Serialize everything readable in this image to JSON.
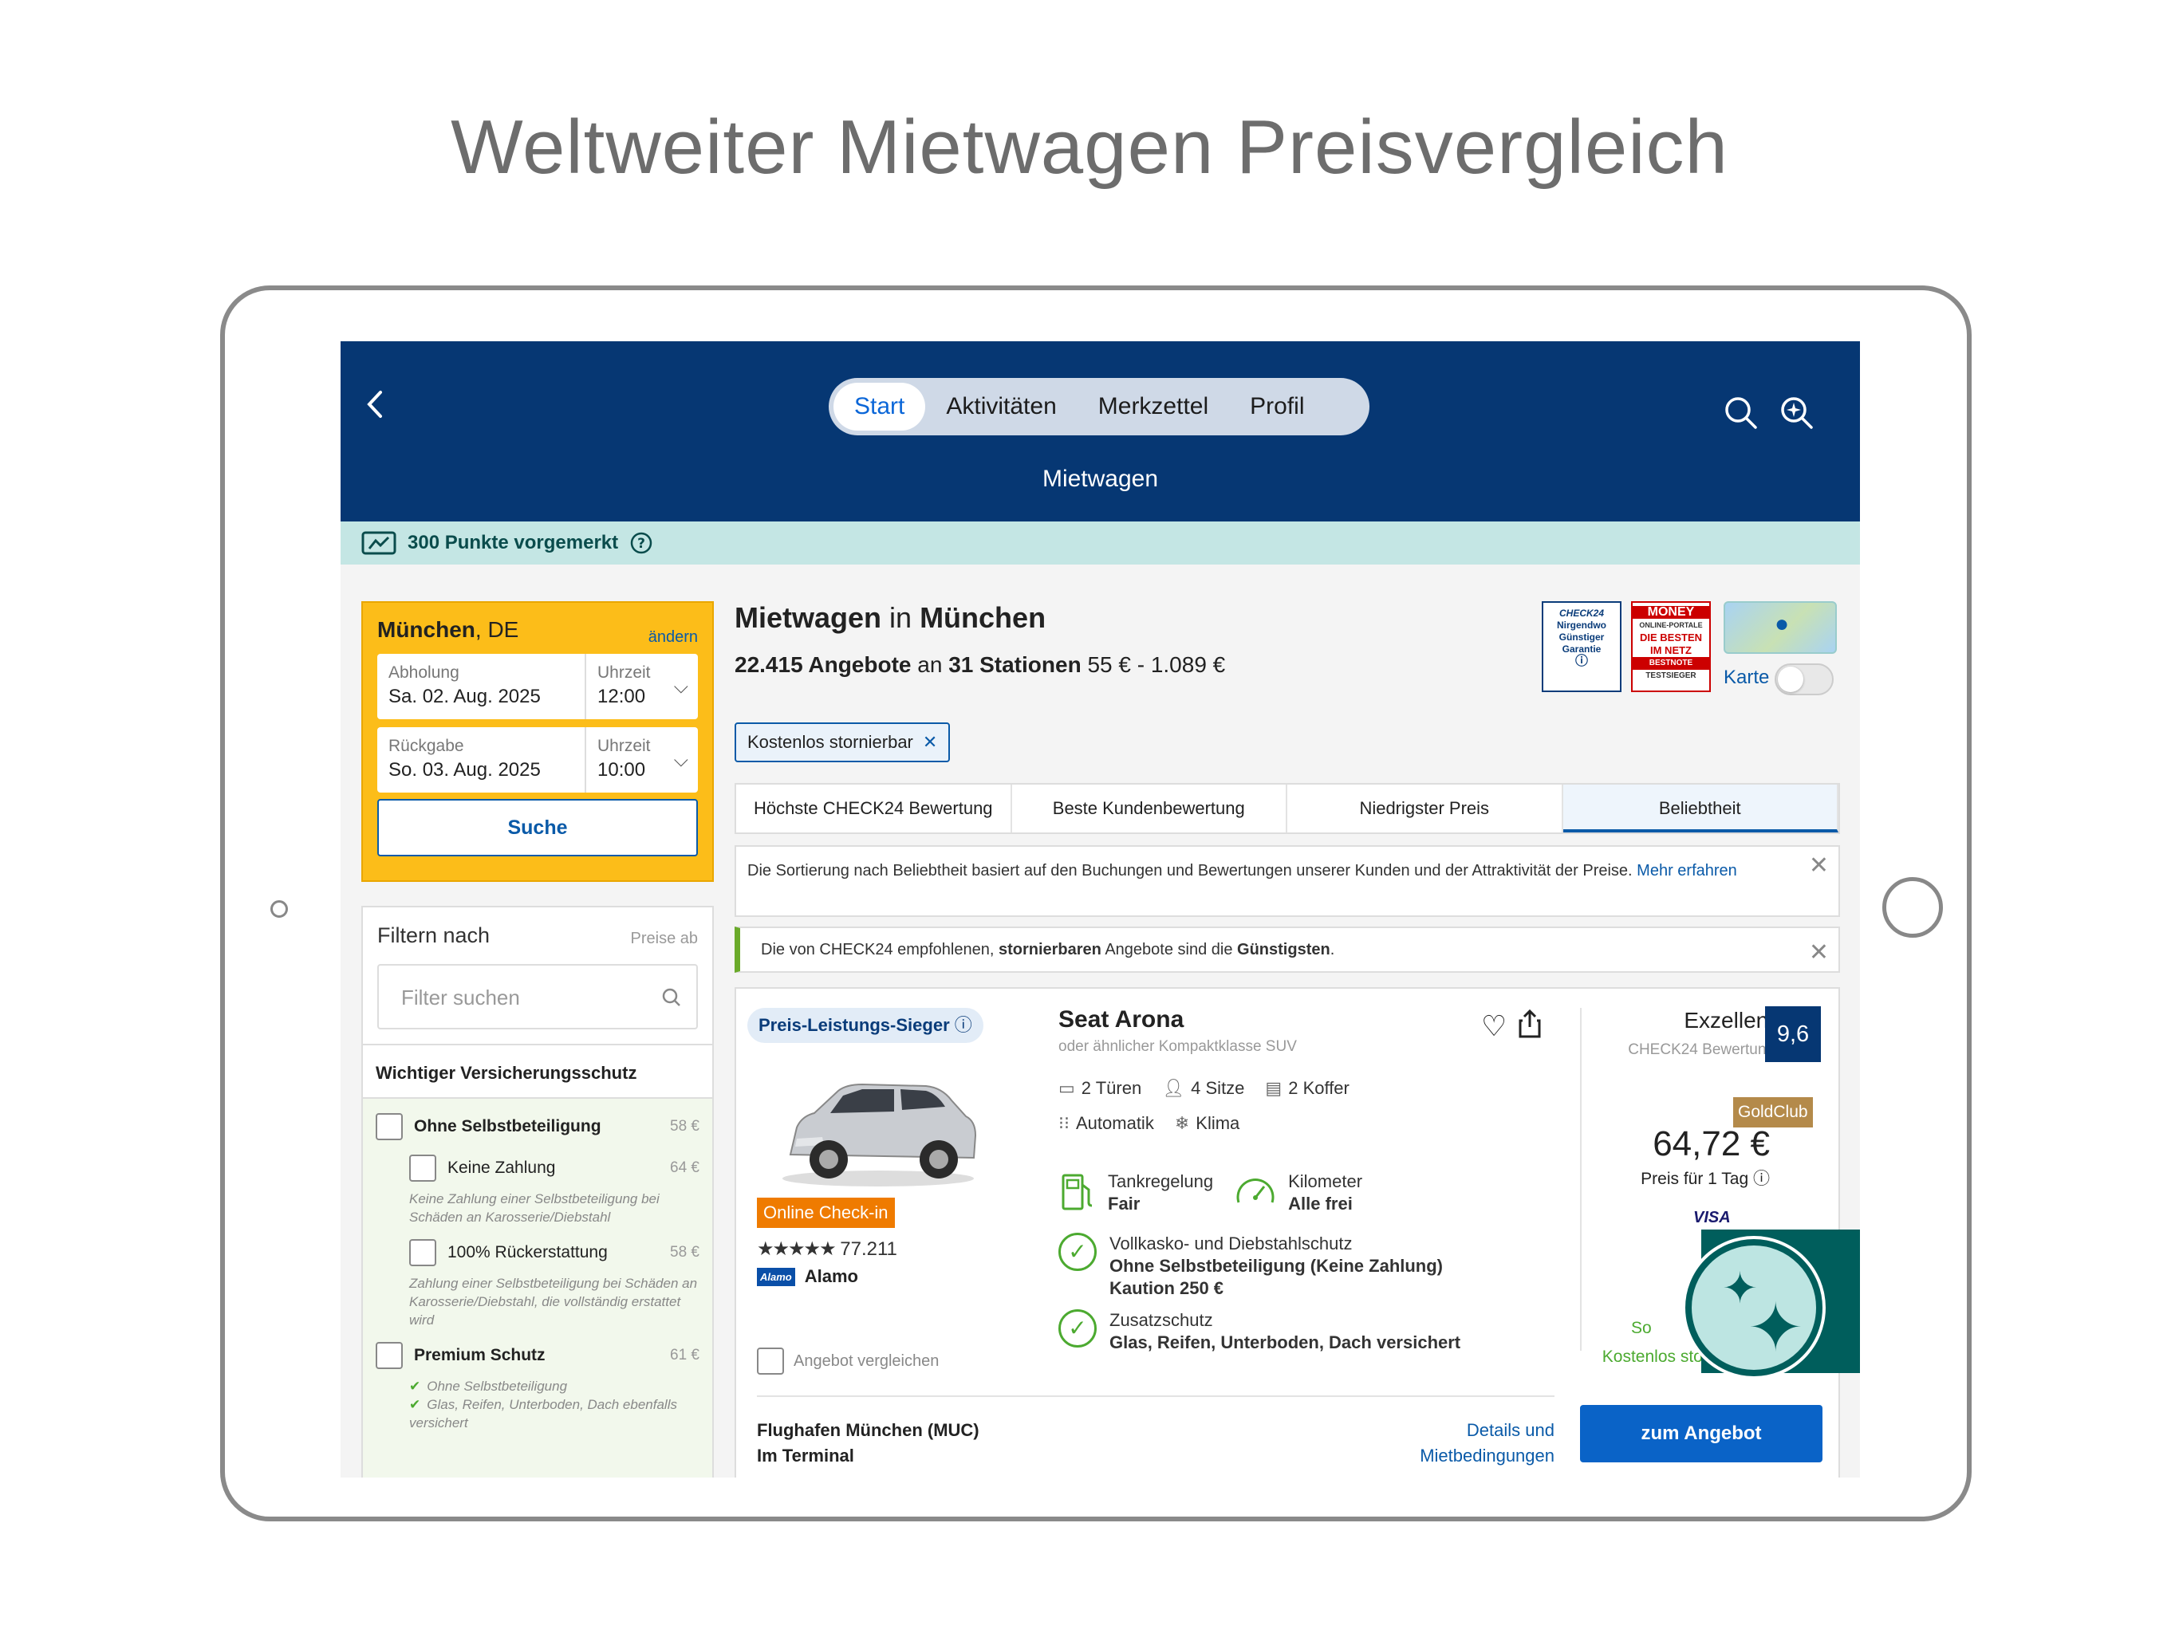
{
  "headline": "Weltweiter Mietwagen Preisvergleich",
  "nav": {
    "tabs": [
      "Start",
      "Aktivitäten",
      "Merkzettel",
      "Profil"
    ],
    "active_tab": "Start",
    "title": "Mietwagen"
  },
  "points_bar": {
    "text": "300 Punkte vorgemerkt"
  },
  "search": {
    "city": "München",
    "country": ", DE",
    "change_label": "ändern",
    "pickup_label": "Abholung",
    "pickup_date": "Sa. 02. Aug. 2025",
    "pickup_time_label": "Uhrzeit",
    "pickup_time": "12:00",
    "return_label": "Rückgabe",
    "return_date": "So. 03. Aug. 2025",
    "return_time_label": "Uhrzeit",
    "return_time": "10:00",
    "search_button": "Suche"
  },
  "filter": {
    "title": "Filtern nach",
    "price_hint": "Preise ab",
    "search_placeholder": "Filter suchen",
    "section_title": "Wichtiger Versicherungsschutz",
    "options": [
      {
        "label": "Ohne Selbstbeteiligung",
        "price": "58 €"
      },
      {
        "label": "Keine Zahlung",
        "price": "64 €",
        "note": "Keine Zahlung einer Selbstbeteiligung bei Schäden an Karosserie/Diebstahl"
      },
      {
        "label": "100% Rückerstattung",
        "price": "58 €",
        "note": "Zahlung einer Selbstbeteiligung bei Schäden an Karosserie/Diebstahl, die vollständig erstattet wird"
      },
      {
        "label": "Premium Schutz",
        "price": "61 €"
      }
    ],
    "premium_checks": [
      "Ohne Selbstbeteiligung",
      "Glas, Reifen, Unterboden, Dach ebenfalls versichert"
    ]
  },
  "main": {
    "title_a": "Mietwagen",
    "title_in": " in ",
    "title_b": "München",
    "count_a": "22.415 Angebote",
    "count_an": " an ",
    "count_b": "31 Stationen",
    "price_range": " 55 € - 1.089 €",
    "chip": "Kostenlos stornierbar",
    "badge1_lines": [
      "CHECK24",
      "Nirgendwo",
      "Günstiger",
      "Garantie"
    ],
    "badge2_lines": [
      "MONEY",
      "ONLINE-PORTALE",
      "DIE BESTEN",
      "IM NETZ",
      "BESTNOTE",
      "TESTSIEGER"
    ],
    "map_label": "Karte",
    "sort_tabs": [
      "Höchste CHECK24 Bewertung",
      "Beste Kundenbewertung",
      "Niedrigster Preis",
      "Beliebtheit"
    ],
    "info1_text": "Die Sortierung nach Beliebtheit basiert auf den Buchungen und Bewertungen unserer Kunden und der Attraktivität der Preise.",
    "info1_link": "Mehr erfahren",
    "info2_a": "Die von CHECK24 empfohlenen, ",
    "info2_b": "stornierbaren",
    "info2_c": " Angebote sind die ",
    "info2_d": "Günstigsten",
    "info2_e": "."
  },
  "offer": {
    "badge": "Preis-Leistungs-Sieger",
    "checkin": "Online Check-in",
    "rating_count": "77.211",
    "vendor_logo": "Alamo",
    "vendor": "Alamo",
    "compare": "Angebot vergleichen",
    "car_name": "Seat Arona",
    "car_sub": "oder ähnlicher Kompaktklasse SUV",
    "doors": "2 Türen",
    "seats": "4 Sitze",
    "bags": "2 Koffer",
    "gear": "Automatik",
    "ac": "Klima",
    "fuel_label": "Tankregelung",
    "fuel_value": "Fair",
    "km_label": "Kilometer",
    "km_value": "Alle frei",
    "cov1_label": "Vollkasko- und Diebstahlschutz",
    "cov1_value": "Ohne Selbstbeteiligung (Keine Zahlung)",
    "cov1_value2": "Kaution 250 €",
    "cov2_label": "Zusatzschutz",
    "cov2_value": "Glas, Reifen, Unterboden, Dach versichert",
    "location_a": "Flughafen München (MUC)",
    "location_b": "Im Terminal",
    "details_a": "Details und",
    "details_b": "Mietbedingungen",
    "rating_word": "Exzellent",
    "rating_sub": "CHECK24 Bewertung",
    "score": "9,6",
    "goldclub": "GoldClub",
    "price": "64,72 €",
    "per_day": "Preis für 1 Tag",
    "visa": "VISA",
    "soft_text": "So",
    "free_cancel": "Kostenlos stornierbar",
    "cta": "zum Angebot"
  }
}
